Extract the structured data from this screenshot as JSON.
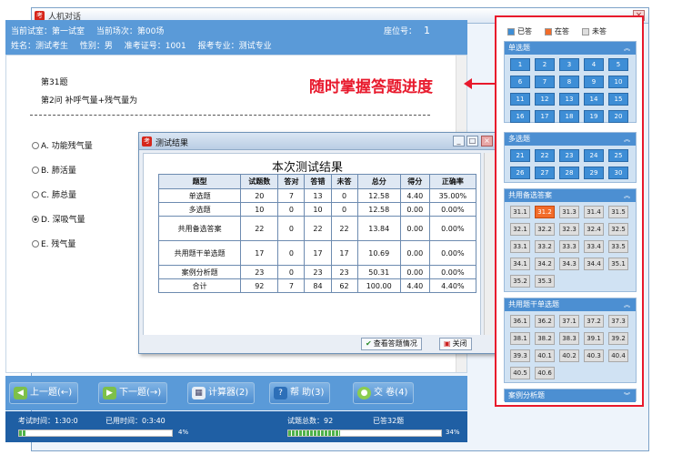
{
  "window": {
    "title": "人机对话",
    "close_glyph": "×"
  },
  "header": {
    "room_label": "当前试室：第一试室",
    "session_label": "当前场次：第00场",
    "seat_label": "座位号：",
    "seat_no": "1",
    "name_label": "姓名：测试考生",
    "gender_label": "性别：男",
    "ticket_label": "准考证号：1001",
    "major_label": "报考专业：测试专业"
  },
  "question": {
    "number": "第31题",
    "text": "第2问   补呼气量+残气量为",
    "options": [
      {
        "label": "A.  功能残气量",
        "selected": false
      },
      {
        "label": "B.  肺活量",
        "selected": false
      },
      {
        "label": "C.  肺总量",
        "selected": false
      },
      {
        "label": "D.  深吸气量",
        "selected": true
      },
      {
        "label": "E.  残气量",
        "selected": false
      }
    ]
  },
  "annotation": {
    "text": "随时掌握答题进度",
    "color": "#e8192c"
  },
  "dialog": {
    "title": "测试结果",
    "heading": "本次测试结果",
    "columns": [
      "题型",
      "试题数",
      "答对",
      "答错",
      "未答",
      "总分",
      "得分",
      "正确率"
    ],
    "rows": [
      [
        "单选题",
        "20",
        "7",
        "13",
        "0",
        "12.58",
        "4.40",
        "35.00%"
      ],
      [
        "多选题",
        "10",
        "0",
        "10",
        "0",
        "12.58",
        "0.00",
        "0.00%"
      ],
      [
        "共用备选答案",
        "22",
        "0",
        "22",
        "22",
        "13.84",
        "0.00",
        "0.00%"
      ],
      [
        "共用题干单选题",
        "17",
        "0",
        "17",
        "17",
        "10.69",
        "0.00",
        "0.00%"
      ],
      [
        "案例分析题",
        "23",
        "0",
        "23",
        "23",
        "50.31",
        "0.00",
        "0.00%"
      ],
      [
        "合计",
        "92",
        "7",
        "84",
        "62",
        "100.00",
        "4.40",
        "4.40%"
      ]
    ],
    "view_button": "查看答题情况",
    "close_button": "关闭"
  },
  "buttons": {
    "prev": "上一题(←)",
    "next": "下一题(→)",
    "calc": "计算器(2)",
    "help": "帮 助(3)",
    "submit": "交 卷(4)"
  },
  "status": {
    "exam_time": "考试时间：1:30:0",
    "used_time": "已用时间：0:3:40",
    "time_percent": "4%",
    "time_progress": 0.04,
    "total_questions": "试题总数：92",
    "answered": "已答32题",
    "answer_percent": "34%",
    "answer_progress": 0.34
  },
  "panel": {
    "legend": [
      {
        "label": "已答",
        "color": "#3e8ed6"
      },
      {
        "label": "在答",
        "color": "#f26c2a"
      },
      {
        "label": "未答",
        "color": "#dedede"
      }
    ],
    "sections": [
      {
        "title": "单选题",
        "chevron": "︽",
        "cells": [
          {
            "n": "1",
            "s": "a"
          },
          {
            "n": "2",
            "s": "a"
          },
          {
            "n": "3",
            "s": "a"
          },
          {
            "n": "4",
            "s": "a"
          },
          {
            "n": "5",
            "s": "a"
          },
          {
            "n": "6",
            "s": "a"
          },
          {
            "n": "7",
            "s": "a"
          },
          {
            "n": "8",
            "s": "a"
          },
          {
            "n": "9",
            "s": "a"
          },
          {
            "n": "10",
            "s": "a"
          },
          {
            "n": "11",
            "s": "a"
          },
          {
            "n": "12",
            "s": "a"
          },
          {
            "n": "13",
            "s": "a"
          },
          {
            "n": "14",
            "s": "a"
          },
          {
            "n": "15",
            "s": "a"
          },
          {
            "n": "16",
            "s": "a"
          },
          {
            "n": "17",
            "s": "a"
          },
          {
            "n": "18",
            "s": "a"
          },
          {
            "n": "19",
            "s": "a"
          },
          {
            "n": "20",
            "s": "a"
          }
        ]
      },
      {
        "title": "多选题",
        "chevron": "︽",
        "cells": [
          {
            "n": "21",
            "s": "a"
          },
          {
            "n": "22",
            "s": "a"
          },
          {
            "n": "23",
            "s": "a"
          },
          {
            "n": "24",
            "s": "a"
          },
          {
            "n": "25",
            "s": "a"
          },
          {
            "n": "26",
            "s": "a"
          },
          {
            "n": "27",
            "s": "a"
          },
          {
            "n": "28",
            "s": "a"
          },
          {
            "n": "29",
            "s": "a"
          },
          {
            "n": "30",
            "s": "a"
          }
        ]
      },
      {
        "title": "共用备选答案",
        "chevron": "︽",
        "cells": [
          {
            "n": "31.1",
            "s": "g"
          },
          {
            "n": "31.2",
            "s": "o"
          },
          {
            "n": "31.3",
            "s": "g"
          },
          {
            "n": "31.4",
            "s": "g"
          },
          {
            "n": "31.5",
            "s": "g"
          },
          {
            "n": "32.1",
            "s": "g"
          },
          {
            "n": "32.2",
            "s": "g"
          },
          {
            "n": "32.3",
            "s": "g"
          },
          {
            "n": "32.4",
            "s": "g"
          },
          {
            "n": "32.5",
            "s": "g"
          },
          {
            "n": "33.1",
            "s": "g"
          },
          {
            "n": "33.2",
            "s": "g"
          },
          {
            "n": "33.3",
            "s": "g"
          },
          {
            "n": "33.4",
            "s": "g"
          },
          {
            "n": "33.5",
            "s": "g"
          },
          {
            "n": "34.1",
            "s": "g"
          },
          {
            "n": "34.2",
            "s": "g"
          },
          {
            "n": "34.3",
            "s": "g"
          },
          {
            "n": "34.4",
            "s": "g"
          },
          {
            "n": "35.1",
            "s": "g"
          },
          {
            "n": "35.2",
            "s": "g"
          },
          {
            "n": "35.3",
            "s": "g"
          }
        ]
      },
      {
        "title": "共用题干单选题",
        "chevron": "︽",
        "cells": [
          {
            "n": "36.1",
            "s": "g"
          },
          {
            "n": "36.2",
            "s": "g"
          },
          {
            "n": "37.1",
            "s": "g"
          },
          {
            "n": "37.2",
            "s": "g"
          },
          {
            "n": "37.3",
            "s": "g"
          },
          {
            "n": "38.1",
            "s": "g"
          },
          {
            "n": "38.2",
            "s": "g"
          },
          {
            "n": "38.3",
            "s": "g"
          },
          {
            "n": "39.1",
            "s": "g"
          },
          {
            "n": "39.2",
            "s": "g"
          },
          {
            "n": "39.3",
            "s": "g"
          },
          {
            "n": "40.1",
            "s": "g"
          },
          {
            "n": "40.2",
            "s": "g"
          },
          {
            "n": "40.3",
            "s": "g"
          },
          {
            "n": "40.4",
            "s": "g"
          },
          {
            "n": "40.5",
            "s": "g"
          },
          {
            "n": "40.6",
            "s": "g"
          }
        ]
      },
      {
        "title": "案例分析题",
        "chevron": "︾",
        "cells": []
      }
    ]
  }
}
